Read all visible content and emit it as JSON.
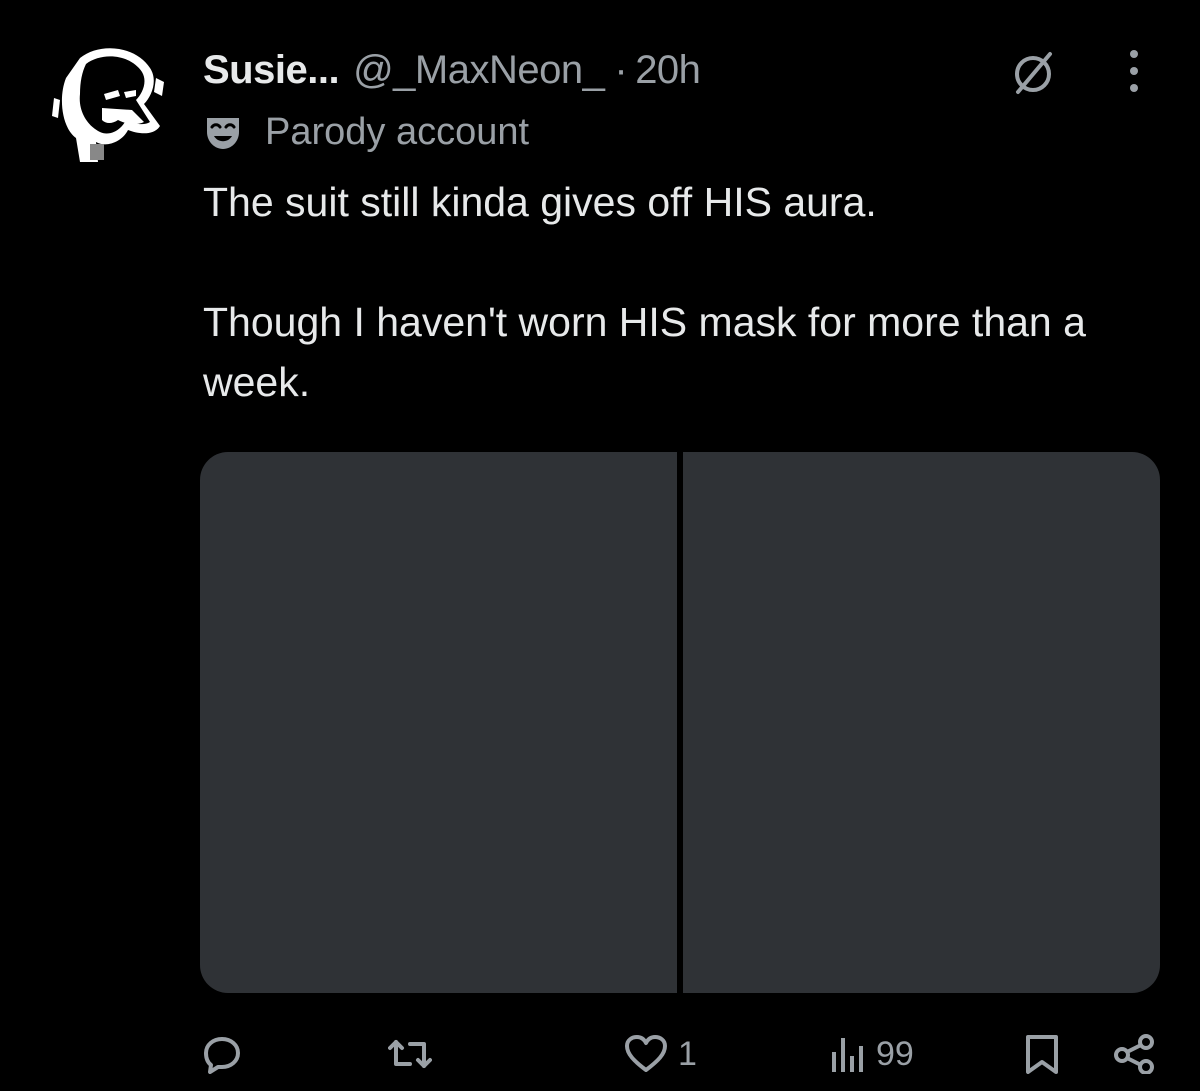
{
  "user": {
    "display_name": "Susie...",
    "handle": "@_MaxNeon_",
    "separator": "·",
    "time": "20h",
    "label": "Parody account"
  },
  "icons": {
    "avatar": "avatar-image",
    "grok": "grok-icon",
    "more": "more-vertical-icon",
    "parody": "theater-mask-icon",
    "reply": "reply-icon",
    "repost": "repost-icon",
    "like": "heart-icon",
    "views": "views-chart-icon",
    "bookmark": "bookmark-icon",
    "share": "share-icon"
  },
  "tweet": {
    "lines": [
      "The suit still kinda gives off HIS aura.",
      "Though I haven't worn HIS mask for more than a week."
    ]
  },
  "media": {
    "count": 2
  },
  "actions": {
    "likes": "1",
    "views": "99"
  },
  "colors": {
    "background": "#000000",
    "text_primary": "#e7e9ea",
    "text_secondary": "#9aa0a6",
    "media_placeholder": "#2f3236"
  }
}
